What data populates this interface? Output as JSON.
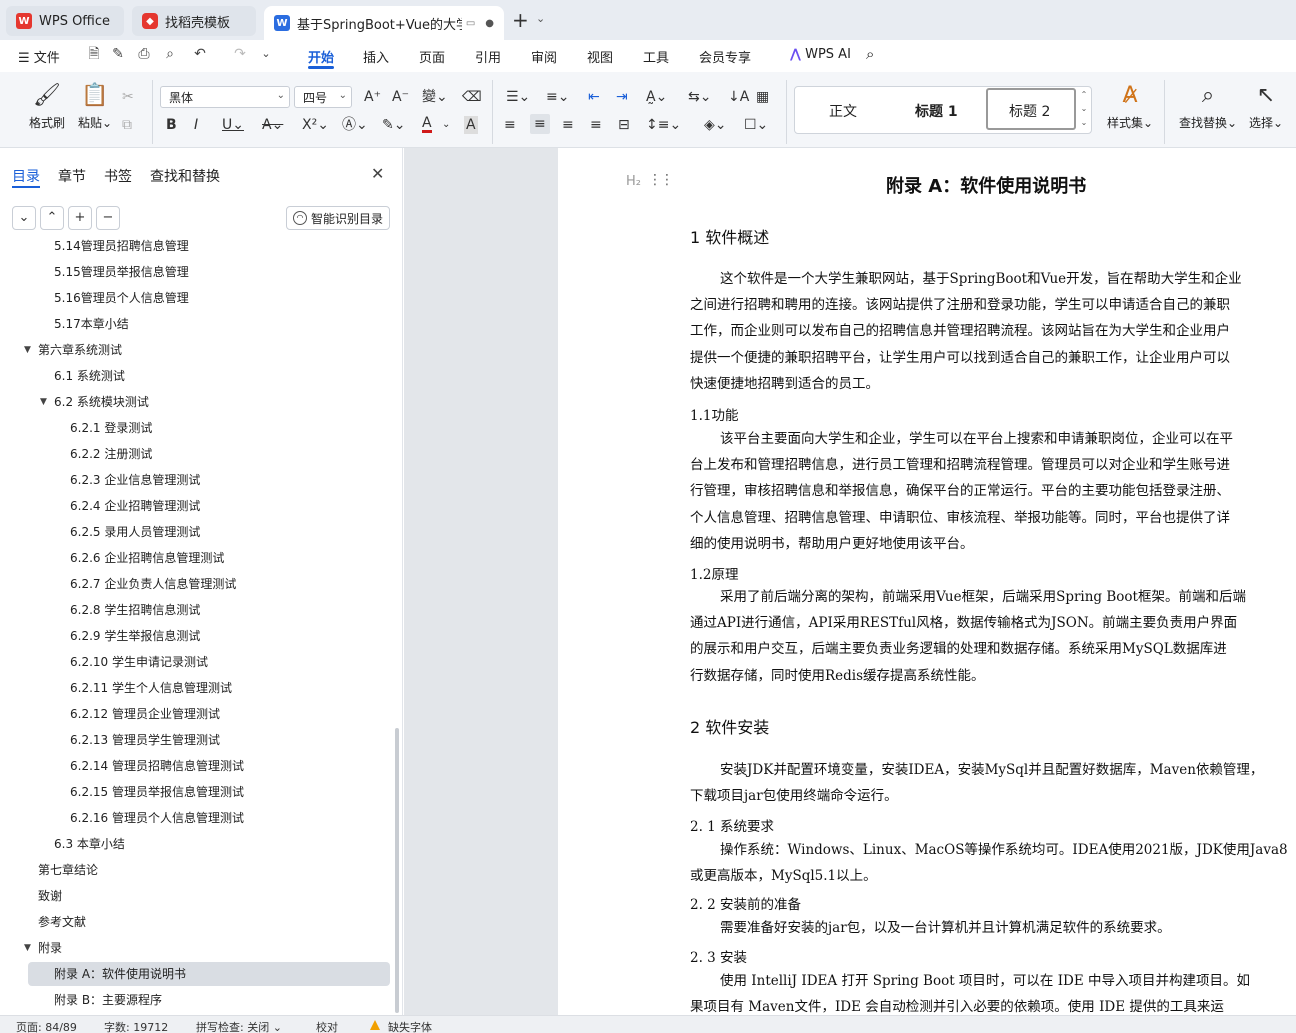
{
  "tabs": [
    {
      "label": "WPS Office",
      "logo": "W"
    },
    {
      "label": "找稻壳模板",
      "logo": "稻"
    },
    {
      "label": "基于SpringBoot+Vue的大学生",
      "logo": "W"
    }
  ],
  "menu": {
    "file": "文件",
    "items": [
      "开始",
      "插入",
      "页面",
      "引用",
      "审阅",
      "视图",
      "工具",
      "会员专享"
    ],
    "ai": "WPS AI"
  },
  "ribbon": {
    "format_painter": "格式刷",
    "paste": "粘贴",
    "font_name": "黑体",
    "font_size": "四号",
    "styles": [
      "正文",
      "标题 1",
      "标题 2"
    ],
    "style_set": "样式集",
    "find_replace": "查找替换",
    "select": "选择"
  },
  "left_panel": {
    "tabs": [
      "目录",
      "章节",
      "书签",
      "查找和替换"
    ],
    "smart_toc": "智能识别目录",
    "toc": [
      {
        "label": "5.14管理员招聘信息管理",
        "level": 2
      },
      {
        "label": "5.15管理员举报信息管理",
        "level": 2
      },
      {
        "label": "5.16管理员个人信息管理",
        "level": 2
      },
      {
        "label": "5.17本章小结",
        "level": 2
      },
      {
        "label": "第六章系统测试",
        "level": 1,
        "expanded": true
      },
      {
        "label": "6.1 系统测试",
        "level": 2
      },
      {
        "label": "6.2 系统模块测试",
        "level": 2,
        "expanded": true
      },
      {
        "label": "6.2.1 登录测试",
        "level": 3
      },
      {
        "label": "6.2.2 注册测试",
        "level": 3
      },
      {
        "label": "6.2.3 企业信息管理测试",
        "level": 3
      },
      {
        "label": "6.2.4 企业招聘管理测试",
        "level": 3
      },
      {
        "label": "6.2.5 录用人员管理测试",
        "level": 3
      },
      {
        "label": "6.2.6 企业招聘信息管理测试",
        "level": 3
      },
      {
        "label": "6.2.7 企业负责人信息管理测试",
        "level": 3
      },
      {
        "label": "6.2.8 学生招聘信息测试",
        "level": 3
      },
      {
        "label": "6.2.9 学生举报信息测试",
        "level": 3
      },
      {
        "label": "6.2.10 学生申请记录测试",
        "level": 3
      },
      {
        "label": "6.2.11 学生个人信息管理测试",
        "level": 3
      },
      {
        "label": "6.2.12 管理员企业管理测试",
        "level": 3
      },
      {
        "label": "6.2.13 管理员学生管理测试",
        "level": 3
      },
      {
        "label": "6.2.14 管理员招聘信息管理测试",
        "level": 3
      },
      {
        "label": "6.2.15 管理员举报信息管理测试",
        "level": 3
      },
      {
        "label": "6.2.16 管理员个人信息管理测试",
        "level": 3
      },
      {
        "label": "6.3 本章小结",
        "level": 2
      },
      {
        "label": "第七章结论",
        "level": 1
      },
      {
        "label": "致谢",
        "level": 1
      },
      {
        "label": "参考文献",
        "level": 1
      },
      {
        "label": "附录",
        "level": 1,
        "expanded": true
      },
      {
        "label": "附录 A：软件使用说明书",
        "level": 2,
        "selected": true
      },
      {
        "label": "附录 B：主要源程序",
        "level": 2
      }
    ]
  },
  "document": {
    "title": "附录 A：软件使用说明书",
    "s1_heading": "1  软件概述",
    "s1_para": [
      "这个软件是一个大学生兼职网站，基于SpringBoot和Vue开发，旨在帮助大学生和企业",
      "之间进行招聘和聘用的连接。该网站提供了注册和登录功能，学生可以申请适合自己的兼职",
      "工作，而企业则可以发布自己的招聘信息并管理招聘流程。该网站旨在为大学生和企业用户",
      "提供一个便捷的兼职招聘平台，让学生用户可以找到适合自己的兼职工作，让企业用户可以",
      "快速便捷地招聘到适合的员工。"
    ],
    "s11_heading": "1.1功能",
    "s11_para": [
      "该平台主要面向大学生和企业，学生可以在平台上搜索和申请兼职岗位，企业可以在平",
      "台上发布和管理招聘信息，进行员工管理和招聘流程管理。管理员可以对企业和学生账号进",
      "行管理，审核招聘信息和举报信息，确保平台的正常运行。平台的主要功能包括登录注册、",
      "个人信息管理、招聘信息管理、申请职位、审核流程、举报功能等。同时，平台也提供了详",
      "细的使用说明书，帮助用户更好地使用该平台。"
    ],
    "s12_heading": "1.2原理",
    "s12_para": [
      "采用了前后端分离的架构，前端采用Vue框架，后端采用Spring Boot框架。前端和后端",
      "通过API进行通信，API采用RESTful风格，数据传输格式为JSON。前端主要负责用户界面",
      "的展示和用户交互，后端主要负责业务逻辑的处理和数据存储。系统采用MySQL数据库进",
      "行数据存储，同时使用Redis缓存提高系统性能。"
    ],
    "s2_heading": "2  软件安装",
    "s2_para": [
      "安装JDK并配置环境变量，安装IDEA，安装MySql并且配置好数据库，Maven依赖管理，",
      "下载项目jar包使用终端命令运行。"
    ],
    "s21_heading": "2. 1  系统要求",
    "s21_para": [
      "操作系统：Windows、Linux、MacOS等操作系统均可。IDEA使用2021版，JDK使用Java8",
      "或更高版本，MySql5.1以上。"
    ],
    "s22_heading": "2. 2  安装前的准备",
    "s22_para": [
      "需要准备好安装的jar包，以及一台计算机并且计算机满足软件的系统要求。"
    ],
    "s23_heading": "2. 3  安装",
    "s23_para": [
      "使用  IntelliJ IDEA  打开  Spring Boot  项目时，可以在  IDE  中导入项目并构建项目。如",
      "果项目有  Maven文件，IDE  会自动检测并引入必要的依赖项。使用  IDE  提供的工具来运"
    ]
  },
  "status": {
    "page": "页面: 84/89",
    "words": "字数: 19712",
    "spell": "拼写检查: 关闭",
    "proof": "校对",
    "missing_font": "缺失字体"
  },
  "colors": {
    "accent": "#1a5fd8",
    "wps_red": "#e5372f"
  }
}
